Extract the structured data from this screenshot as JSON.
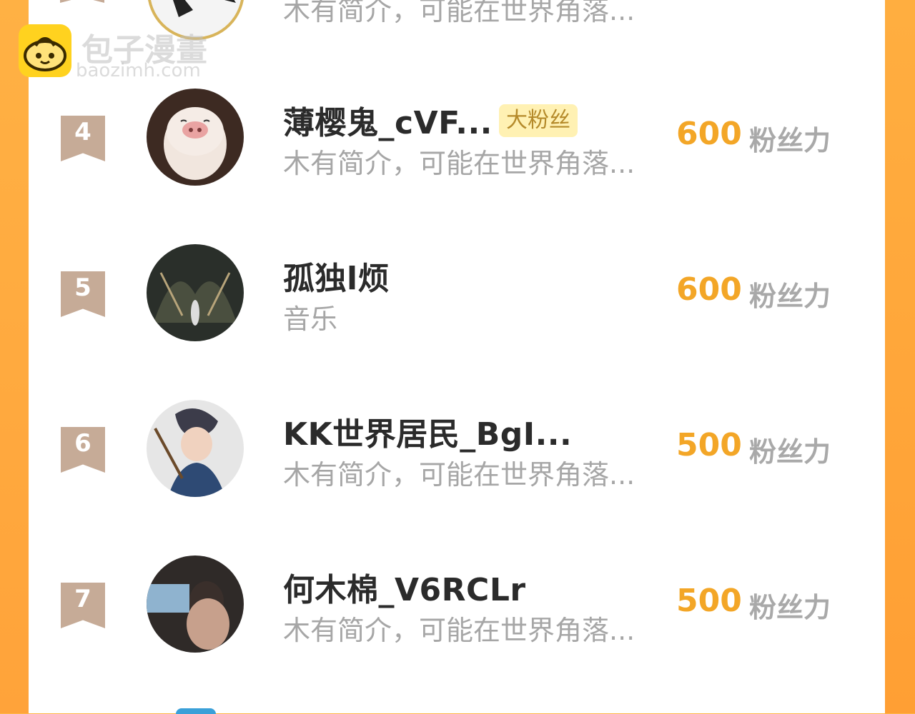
{
  "watermark": {
    "title": "包子漫畫",
    "site": "baozimh.com",
    "icon": "bun-logo-icon"
  },
  "top_partial": {
    "desc": "木有简介，可能在世界角落..."
  },
  "list": [
    {
      "rank": "4",
      "name": "薄樱鬼_cVF...",
      "badge": "大粉丝",
      "desc": "木有简介，可能在世界角落...",
      "score": "600",
      "unit": "粉丝力"
    },
    {
      "rank": "5",
      "name": "孤独l烦",
      "badge": "",
      "desc": "音乐",
      "score": "600",
      "unit": "粉丝力"
    },
    {
      "rank": "6",
      "name": "KK世界居民_BgI...",
      "badge": "",
      "desc": "木有简介，可能在世界角落...",
      "score": "500",
      "unit": "粉丝力"
    },
    {
      "rank": "7",
      "name": "何木棉_V6RCLr",
      "badge": "",
      "desc": "木有简介，可能在世界角落...",
      "score": "500",
      "unit": "粉丝力"
    }
  ],
  "colors": {
    "accent_orange": "#ffa63a",
    "score_orange": "#f3a627",
    "rank_badge": "#c6ab97",
    "badge_bg": "#fff1b3"
  }
}
